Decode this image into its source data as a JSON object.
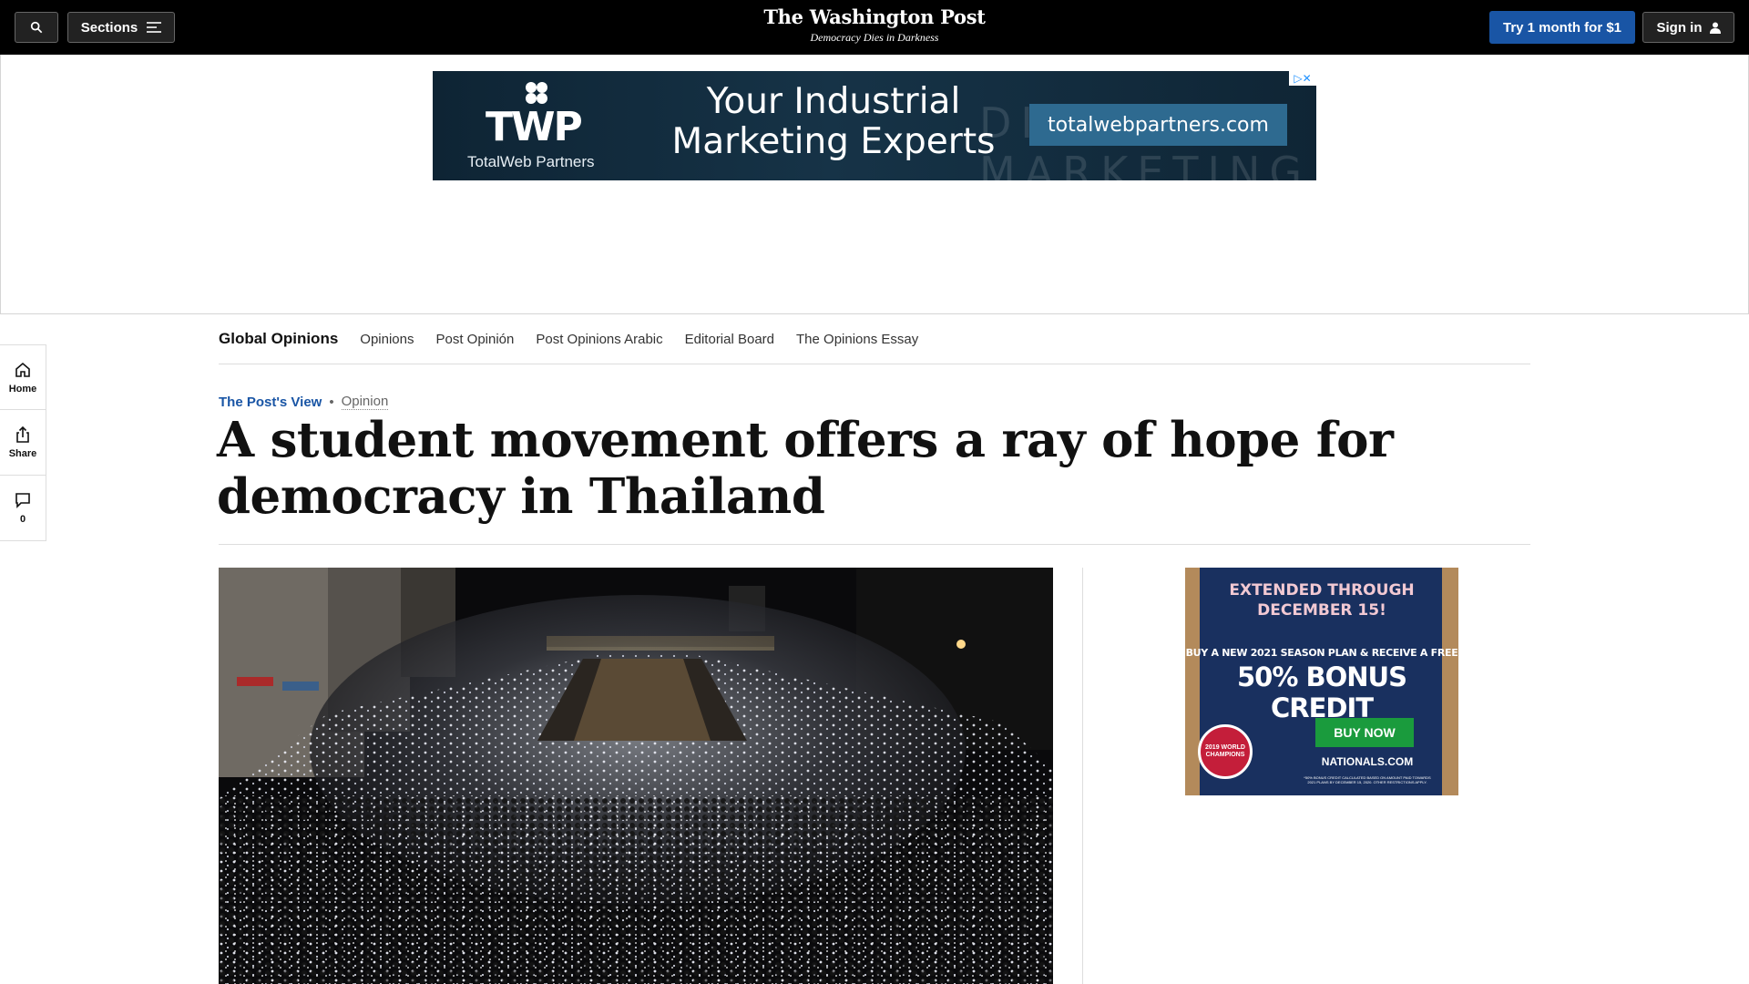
{
  "topbar": {
    "sections_label": "Sections",
    "logo_name": "The Washington Post",
    "logo_tagline": "Democracy Dies in Darkness",
    "try_label": "Try 1 month for $1",
    "signin_label": "Sign in"
  },
  "banner_ad": {
    "brand_short": "TWP",
    "brand_full": "TotalWeb Partners",
    "headline": "Your Industrial Marketing Experts",
    "url": "totalwebpartners.com",
    "background_text": "DIGITAL MARKETING"
  },
  "section_nav": {
    "title": "Global Opinions",
    "items": [
      "Opinions",
      "Post Opinión",
      "Post Opinions Arabic",
      "Editorial Board",
      "The Opinions Essay"
    ]
  },
  "rail": {
    "home_label": "Home",
    "share_label": "Share",
    "comments_count": "0"
  },
  "article": {
    "kicker_label": "The Post's View",
    "kicker_separator": "•",
    "kicker_opinion": "Opinion",
    "headline": "A student movement offers a ray of hope for democracy in Thailand"
  },
  "side_ad": {
    "line1": "EXTENDED THROUGH DECEMBER 15!",
    "line2": "BUY A NEW 2021 SEASON PLAN & RECEIVE A FREE",
    "line3": "50% BONUS CREDIT",
    "button": "BUY NOW",
    "url": "NATIONALS.COM",
    "badge": "2019 WORLD CHAMPIONS",
    "fine_print": "*50% BONUS CREDIT CALCULATED BASED ON AMOUNT PAID TOWARDS 2021 PLANS BY DECEMBER 15, 2020. OTHER RESTRICTIONS APPLY."
  },
  "colors": {
    "brand_blue": "#1955a5",
    "topbar": "#000000",
    "buy_green": "#1a9b3d",
    "nationals_navy": "#19305f"
  }
}
